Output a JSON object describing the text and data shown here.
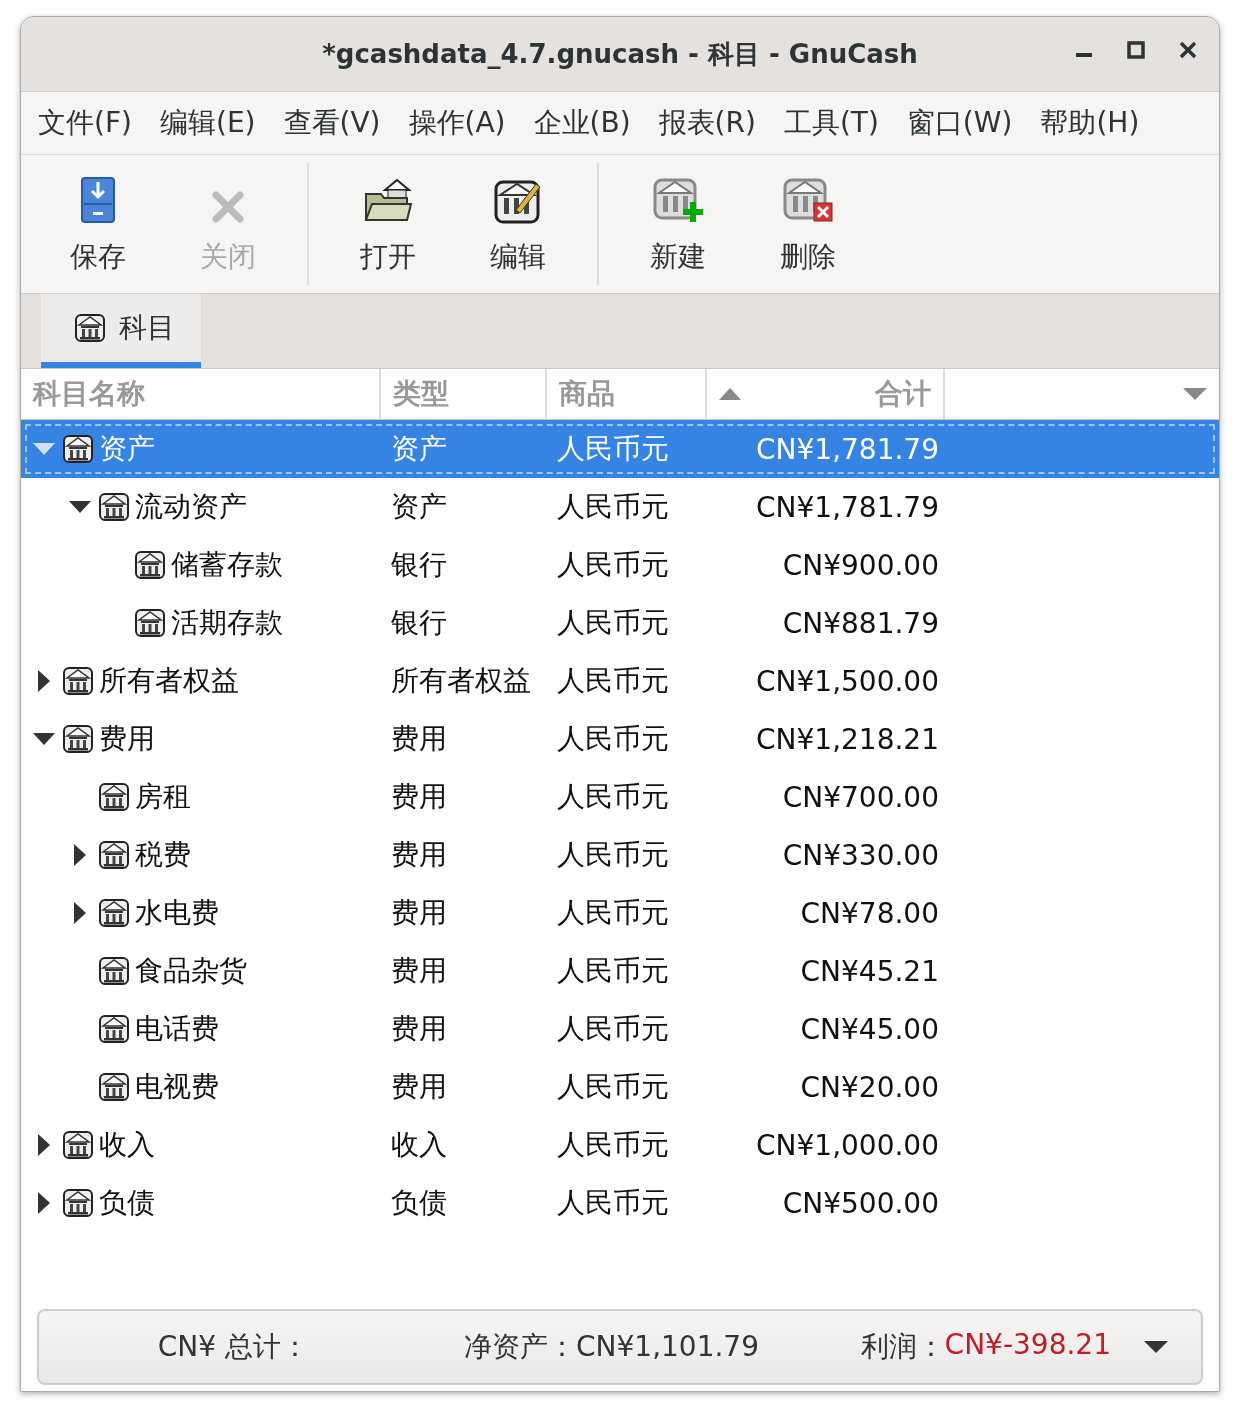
{
  "window": {
    "title": "*gcashdata_4.7.gnucash - 科目 - GnuCash"
  },
  "menu": [
    "文件(F)",
    "编辑(E)",
    "查看(V)",
    "操作(A)",
    "企业(B)",
    "报表(R)",
    "工具(T)",
    "窗口(W)",
    "帮助(H)"
  ],
  "toolbar": [
    {
      "kind": "save",
      "label": "保存",
      "disabled": false
    },
    {
      "kind": "close",
      "label": "关闭",
      "disabled": true
    },
    {
      "kind": "separator"
    },
    {
      "kind": "open",
      "label": "打开",
      "disabled": false
    },
    {
      "kind": "edit",
      "label": "编辑",
      "disabled": false
    },
    {
      "kind": "separator"
    },
    {
      "kind": "new",
      "label": "新建",
      "disabled": false
    },
    {
      "kind": "delete",
      "label": "删除",
      "disabled": false
    }
  ],
  "tabs": [
    {
      "label": "科目",
      "selected": true
    }
  ],
  "table": {
    "columns": [
      {
        "label": "科目名称",
        "sorted": false
      },
      {
        "label": "类型",
        "sorted": false
      },
      {
        "label": "商品",
        "sorted": false
      },
      {
        "label": "合计",
        "sorted": true
      }
    ],
    "rows": [
      {
        "name": "资产",
        "type": "资产",
        "commodity": "人民币元",
        "total": "CN¥1,781.79",
        "expanded": true,
        "selected": true,
        "children": [
          {
            "name": "流动资产",
            "type": "资产",
            "commodity": "人民币元",
            "total": "CN¥1,781.79",
            "expanded": true,
            "selected": false,
            "children": [
              {
                "name": "储蓄存款",
                "type": "银行",
                "commodity": "人民币元",
                "total": "CN¥900.00",
                "selected": false
              },
              {
                "name": "活期存款",
                "type": "银行",
                "commodity": "人民币元",
                "total": "CN¥881.79",
                "selected": false
              }
            ]
          }
        ]
      },
      {
        "name": "所有者权益",
        "type": "所有者权益",
        "commodity": "人民币元",
        "total": "CN¥1,500.00",
        "expanded": false,
        "selected": false
      },
      {
        "name": "费用",
        "type": "费用",
        "commodity": "人民币元",
        "total": "CN¥1,218.21",
        "expanded": true,
        "selected": false,
        "children": [
          {
            "name": "房租",
            "type": "费用",
            "commodity": "人民币元",
            "total": "CN¥700.00",
            "selected": false
          },
          {
            "name": "税费",
            "type": "费用",
            "commodity": "人民币元",
            "total": "CN¥330.00",
            "expanded": false,
            "selected": false
          },
          {
            "name": "水电费",
            "type": "费用",
            "commodity": "人民币元",
            "total": "CN¥78.00",
            "expanded": false,
            "selected": false
          },
          {
            "name": "食品杂货",
            "type": "费用",
            "commodity": "人民币元",
            "total": "CN¥45.21",
            "selected": false
          },
          {
            "name": "电话费",
            "type": "费用",
            "commodity": "人民币元",
            "total": "CN¥45.00",
            "selected": false
          },
          {
            "name": "电视费",
            "type": "费用",
            "commodity": "人民币元",
            "total": "CN¥20.00",
            "selected": false
          }
        ]
      },
      {
        "name": "收入",
        "type": "收入",
        "commodity": "人民币元",
        "total": "CN¥1,000.00",
        "expanded": false,
        "selected": false
      },
      {
        "name": "负债",
        "type": "负债",
        "commodity": "人民币元",
        "total": "CN¥500.00",
        "expanded": false,
        "selected": false
      }
    ]
  },
  "status_bar": {
    "total_label": "CN¥ 总计：",
    "net_assets": "净资产：CN¥1,101.79",
    "profit_label": "利润：",
    "profit_value": "CN¥-398.21",
    "profit_negative": true
  }
}
